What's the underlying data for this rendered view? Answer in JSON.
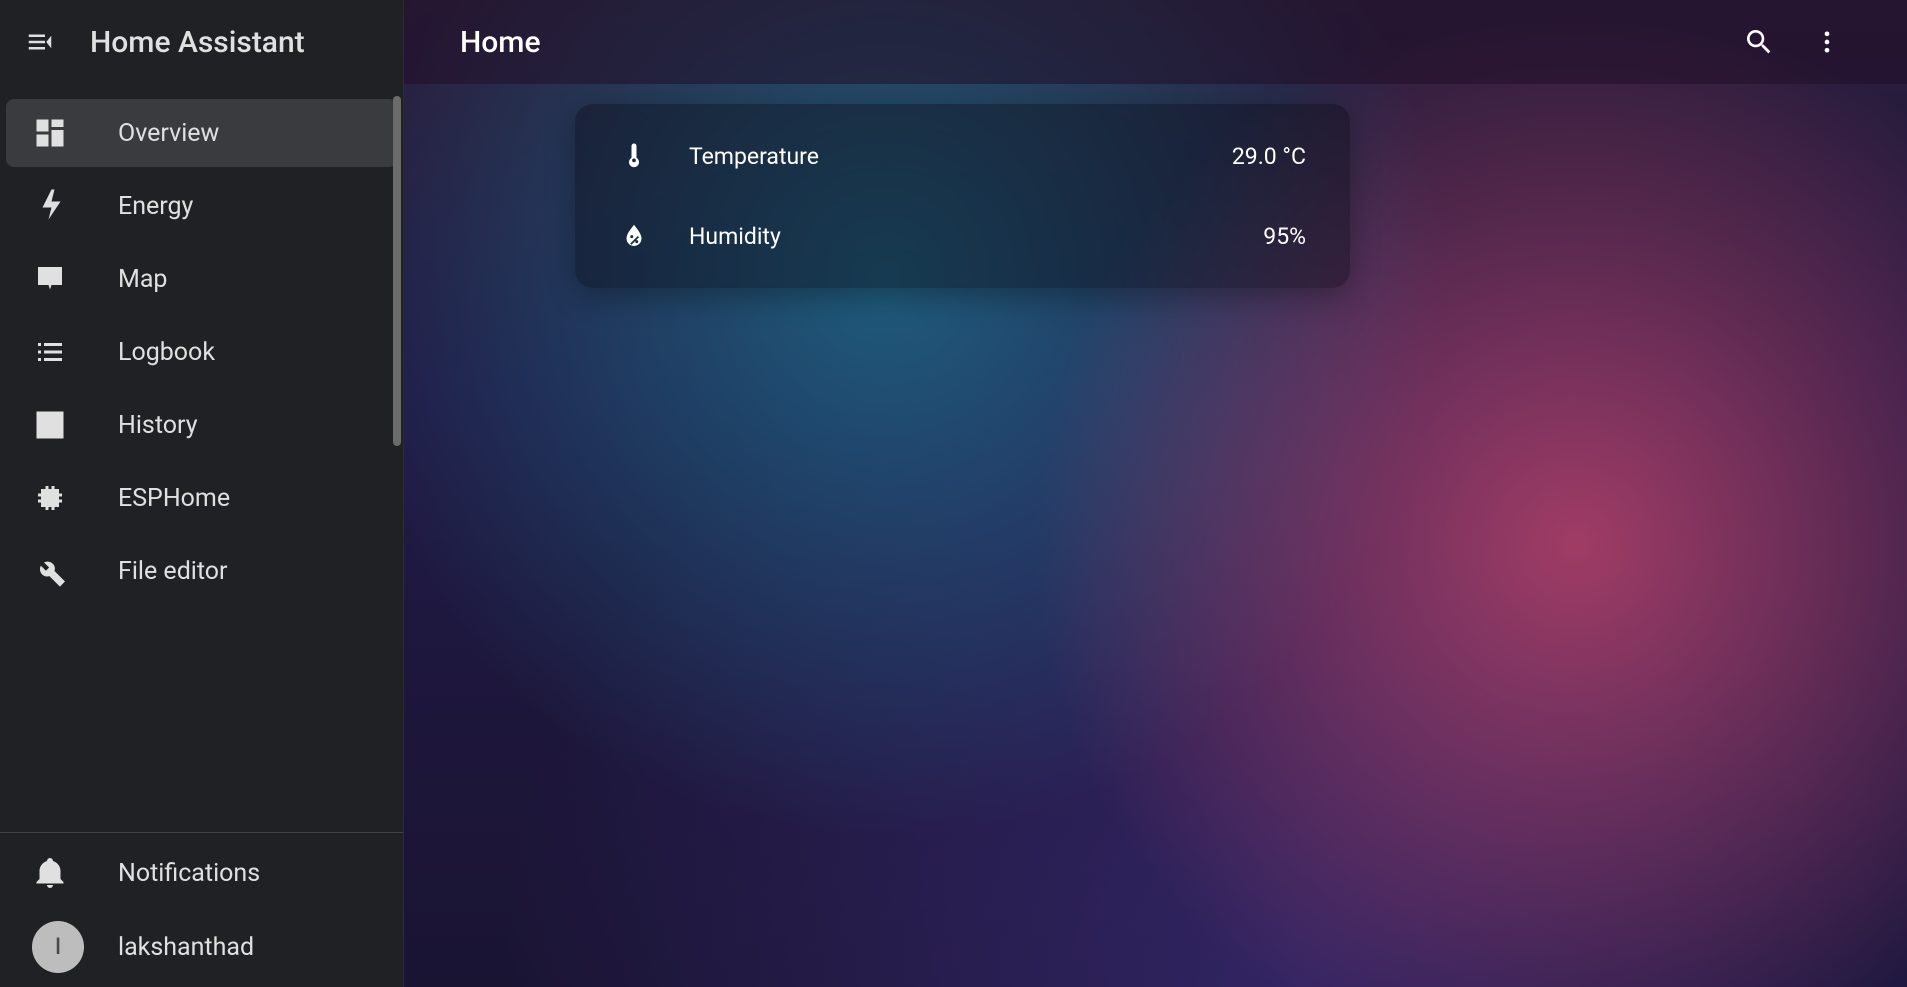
{
  "app_title": "Home Assistant",
  "sidebar": {
    "items": [
      {
        "label": "Overview",
        "icon": "dashboard-icon",
        "active": true
      },
      {
        "label": "Energy",
        "icon": "bolt-icon",
        "active": false
      },
      {
        "label": "Map",
        "icon": "map-pin-icon",
        "active": false
      },
      {
        "label": "Logbook",
        "icon": "list-icon",
        "active": false
      },
      {
        "label": "History",
        "icon": "chart-box-icon",
        "active": false
      },
      {
        "label": "ESPHome",
        "icon": "chip-icon",
        "active": false
      },
      {
        "label": "File editor",
        "icon": "wrench-icon",
        "active": false
      }
    ],
    "notifications_label": "Notifications",
    "user": {
      "name": "lakshanthad",
      "initial": "l"
    }
  },
  "header": {
    "title": "Home"
  },
  "card": {
    "entities": [
      {
        "name": "Temperature",
        "value": "29.0 °C",
        "icon": "thermometer-icon"
      },
      {
        "name": "Humidity",
        "value": "95%",
        "icon": "humidity-icon"
      }
    ]
  }
}
